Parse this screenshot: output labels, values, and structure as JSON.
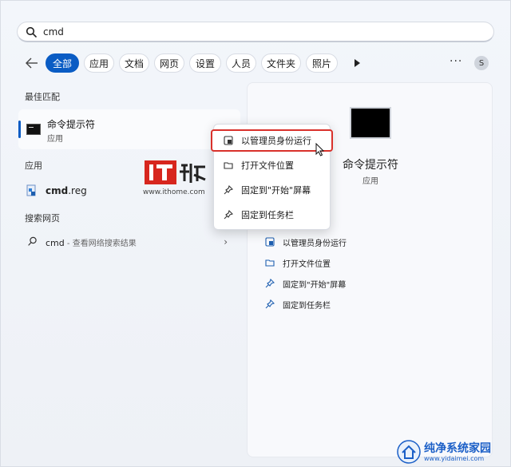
{
  "search": {
    "query": "cmd"
  },
  "tabs": [
    "全部",
    "应用",
    "文档",
    "网页",
    "设置",
    "人员",
    "文件夹",
    "照片"
  ],
  "toolbar": {
    "more_dots": "···",
    "avatar_letter": "S"
  },
  "sections": {
    "best_match": "最佳匹配",
    "apps": "应用",
    "web": "搜索网页"
  },
  "best_match": {
    "title": "命令提示符",
    "subtitle": "应用"
  },
  "apps": [
    {
      "name_bold": "cmd",
      "name_rest": ".reg"
    }
  ],
  "web_result": {
    "query": "cmd",
    "hint": " - 查看网络搜索结果",
    "chevron": "›"
  },
  "detail": {
    "name": "命令提示符",
    "kind": "应用",
    "actions": [
      "以管理员身份运行",
      "打开文件位置",
      "固定到\"开始\"屏幕",
      "固定到任务栏"
    ]
  },
  "context_menu": {
    "items": [
      "以管理员身份运行",
      "打开文件位置",
      "固定到\"开始\"屏幕",
      "固定到任务栏"
    ],
    "highlighted_index": 0
  },
  "watermarks": {
    "ithome_url": "www.ithome.com",
    "ithome_logo_text": "IT之家",
    "corner_title": "纯净系统家园",
    "corner_url": "www.yidaimei.com"
  },
  "colors": {
    "accent": "#0a5cc4",
    "highlight_border": "#d9312b"
  }
}
